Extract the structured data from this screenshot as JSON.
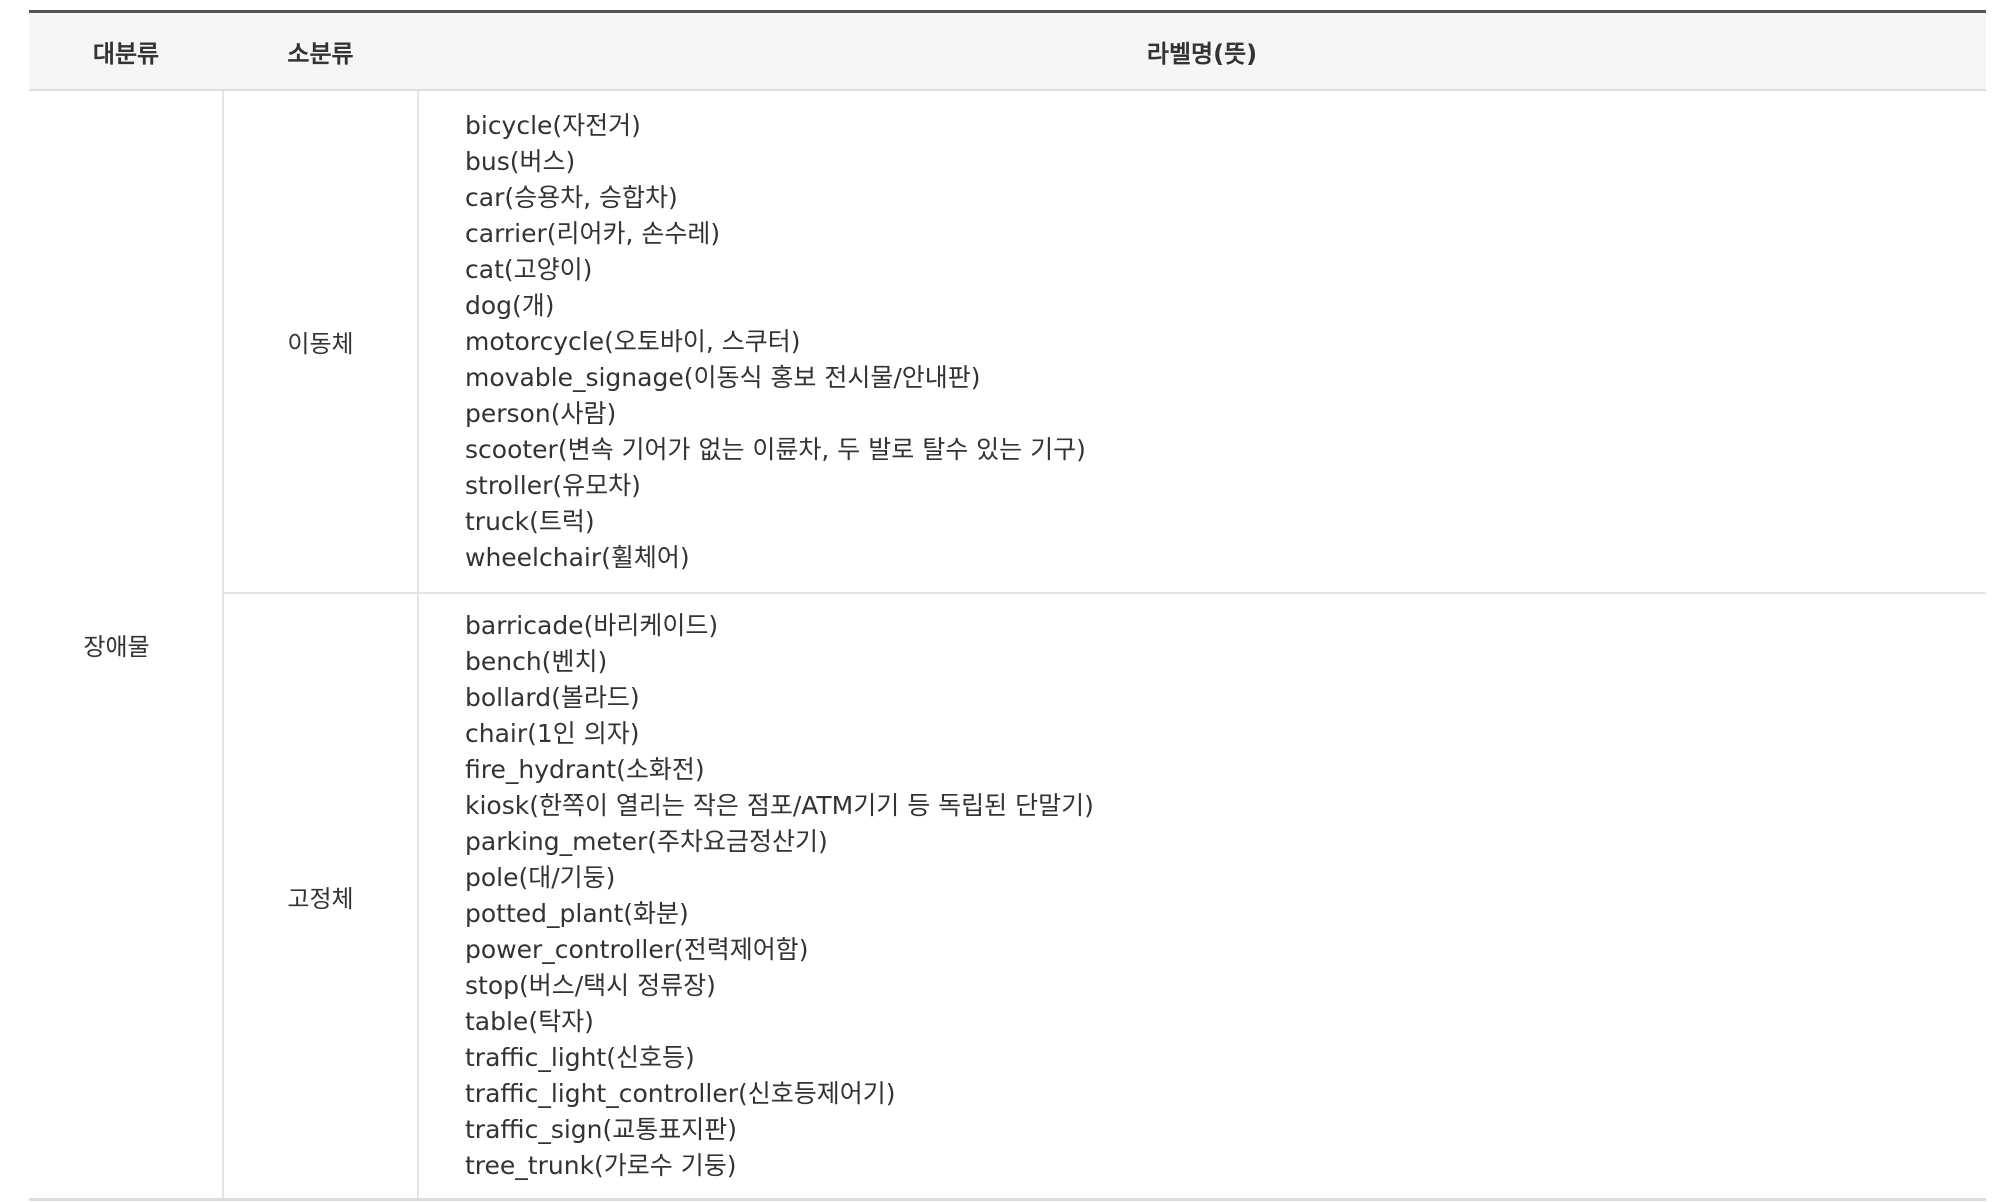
{
  "table": {
    "headers": {
      "major": "대분류",
      "minor": "소분류",
      "label": "라벨명(뜻)"
    },
    "major_category": "장애물",
    "groups": [
      {
        "minor": "이동체",
        "labels": [
          "bicycle(자전거)",
          "bus(버스)",
          "car(승용차, 승합차)",
          "carrier(리어카, 손수레)",
          "cat(고양이)",
          "dog(개)",
          "motorcycle(오토바이, 스쿠터)",
          "movable_signage(이동식 홍보 전시물/안내판)",
          "person(사람)",
          "scooter(변속 기어가 없는 이륜차, 두 발로 탈수 있는 기구)",
          "stroller(유모차)",
          "truck(트럭)",
          "wheelchair(휠체어)"
        ]
      },
      {
        "minor": "고정체",
        "labels": [
          "barricade(바리케이드)",
          "bench(벤치)",
          "bollard(볼라드)",
          "chair(1인 의자)",
          "fire_hydrant(소화전)",
          "kiosk(한쪽이 열리는 작은 점포/ATM기기 등 독립된 단말기)",
          "parking_meter(주차요금정산기)",
          "pole(대/기둥)",
          "potted_plant(화분)",
          "power_controller(전력제어함)",
          "stop(버스/택시 정류장)",
          "table(탁자)",
          "traffic_light(신호등)",
          "traffic_light_controller(신호등제어기)",
          "traffic_sign(교통표지판)",
          "tree_trunk(가로수 기둥)"
        ]
      }
    ]
  }
}
